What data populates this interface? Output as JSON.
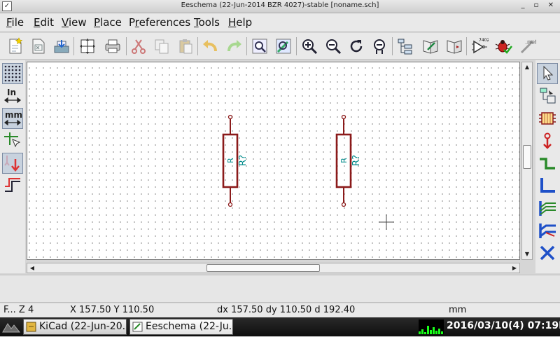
{
  "window": {
    "title": "Eeschema (22-Jun-2014 BZR 4027)-stable [noname.sch]",
    "controls": "_ ▫ ✕"
  },
  "menu": {
    "items": [
      {
        "label": "File",
        "accel": "F",
        "rest": "ile"
      },
      {
        "label": "Edit",
        "accel": "E",
        "rest": "dit"
      },
      {
        "label": "View",
        "accel": "V",
        "rest": "iew"
      },
      {
        "label": "Place",
        "accel": "P",
        "rest": "lace"
      },
      {
        "label": "Preferences",
        "accel": "r",
        "pre": "P",
        "rest": "eferences"
      },
      {
        "label": "Tools",
        "accel": "T",
        "rest": "ools"
      },
      {
        "label": "Help",
        "accel": "H",
        "rest": "elp"
      }
    ]
  },
  "toolbar": {
    "icons": [
      "new-schematic-icon",
      "open-schematic-icon",
      "save-icon",
      "page-settings-icon",
      "print-icon",
      "cut-icon",
      "copy-icon",
      "paste-icon",
      "undo-icon",
      "redo-icon",
      "find-icon",
      "find-replace-icon",
      "zoom-in-icon",
      "zoom-out-icon",
      "redraw-icon",
      "zoom-fit-icon",
      "hierarchy-navigator-icon",
      "library-editor-icon",
      "library-browser-icon",
      "annotate-icon",
      "erc-icon",
      "netlist-icon"
    ],
    "annotate_label": "7402",
    "netlist_label": ".net"
  },
  "left_tools": [
    "grid-toggle-icon",
    "units-inch-icon",
    "units-mm-icon",
    "cursor-shape-icon",
    "hidden-pins-icon",
    "bus-wire-orientation-icon"
  ],
  "left_tool_labels": {
    "inch": "In",
    "mm": "mm"
  },
  "right_tools": [
    "select-arrow-icon",
    "hierarchy-push-pop-icon",
    "place-component-icon",
    "place-power-icon",
    "place-wire-icon",
    "place-bus-icon",
    "wire-bus-entry-icon",
    "bus-bus-entry-icon",
    "no-connect-icon"
  ],
  "schematic": {
    "components": [
      {
        "reference": "R?",
        "value": "R"
      },
      {
        "reference": "R?",
        "value": "R"
      }
    ],
    "colors": {
      "body": "#8b1a1a",
      "text": "#008b8b",
      "grid": "#8a8a8a"
    }
  },
  "status": {
    "zoom": "F... Z 4",
    "xy": "X 157.50  Y 110.50",
    "delta": "dx 157.50  dy 110.50  d 192.40",
    "units": "mm"
  },
  "taskbar": {
    "tasks": [
      {
        "label": "KiCad (22-Jun-20..."
      },
      {
        "label": "Eeschema (22-Ju..."
      }
    ],
    "clock": "2016/03/10(4) 07:19PM"
  }
}
